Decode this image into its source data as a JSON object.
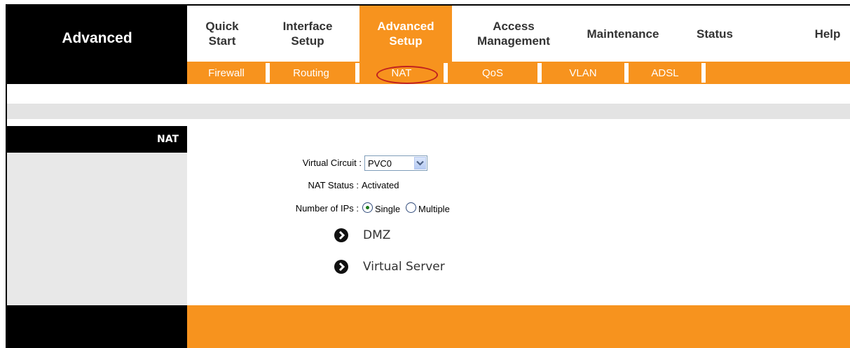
{
  "header": {
    "section_title": "Advanced"
  },
  "topnav": [
    {
      "label": "Quick\nStart",
      "active": false
    },
    {
      "label": "Interface\nSetup",
      "active": false
    },
    {
      "label": "Advanced\nSetup",
      "active": true
    },
    {
      "label": "Access\nManagement",
      "active": false
    },
    {
      "label": "Maintenance",
      "active": false
    },
    {
      "label": "Status",
      "active": false
    },
    {
      "label": "Help",
      "active": false
    }
  ],
  "subnav": [
    {
      "label": "Firewall"
    },
    {
      "label": "Routing"
    },
    {
      "label": "NAT",
      "selected": true
    },
    {
      "label": "QoS"
    },
    {
      "label": "VLAN"
    },
    {
      "label": "ADSL"
    }
  ],
  "sidebar": {
    "section_label": "NAT"
  },
  "form": {
    "virtual_circuit_label": "Virtual Circuit :",
    "virtual_circuit_value": "PVC0",
    "nat_status_label": "NAT Status :",
    "nat_status_value": "Activated",
    "num_ips_label": "Number of IPs :",
    "num_ips_options": [
      "Single",
      "Multiple"
    ],
    "num_ips_selected": "Single"
  },
  "links": [
    {
      "label": "DMZ",
      "icon": "arrow-right-circle-icon"
    },
    {
      "label": "Virtual Server",
      "icon": "arrow-right-circle-icon"
    }
  ],
  "colors": {
    "accent": "#f7931e",
    "dark": "#000000",
    "panel": "#e8e8e8",
    "highlight": "#c0201f"
  }
}
